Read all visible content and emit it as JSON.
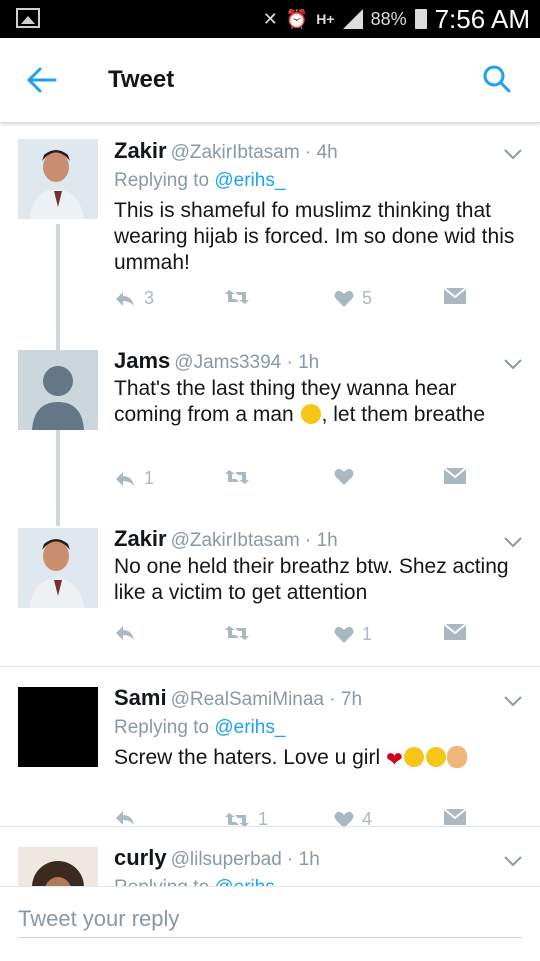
{
  "status_bar": {
    "battery": "88%",
    "time": "7:56 AM",
    "network": "H+"
  },
  "header": {
    "title": "Tweet"
  },
  "tweets": [
    {
      "name": "Zakir",
      "handle": "@ZakirIbtasam · 4h",
      "replying_label": "Replying to",
      "replying_to": "@erihs_",
      "text": "This is shameful fo muslimz thinking that wearing hijab is forced. Im so done wid this ummah!",
      "replies": "3",
      "retweets": "",
      "likes": "5"
    },
    {
      "name": "Jams",
      "handle": "@Jams3394 · 1h",
      "text_before": "That's the last thing they wanna hear coming from a man ",
      "emoji": "😂",
      "text_after": ", let them breathe",
      "replies": "1",
      "retweets": "",
      "likes": ""
    },
    {
      "name": "Zakir",
      "handle": "@ZakirIbtasam · 1h",
      "text": "No one held their breathz btw. Shez acting like a victim to get attention",
      "replies": "",
      "retweets": "",
      "likes": "1"
    },
    {
      "name": "Sami",
      "handle": "@RealSamiMinaa · 7h",
      "replying_label": "Replying to",
      "replying_to": "@erihs_",
      "text": "Screw the haters. Love u girl ",
      "replies": "",
      "retweets": "1",
      "likes": "4"
    },
    {
      "name": "curly",
      "handle": "@lilsuperbad · 1h",
      "replying_label": "Replying to",
      "replying_to": "@erihs_"
    }
  ],
  "composer": {
    "placeholder": "Tweet your reply"
  },
  "colors": {
    "accent": "#1da1f2",
    "muted": "#8899a6",
    "icon": "#aab8c2",
    "heart_emoji": "#d0021b"
  }
}
